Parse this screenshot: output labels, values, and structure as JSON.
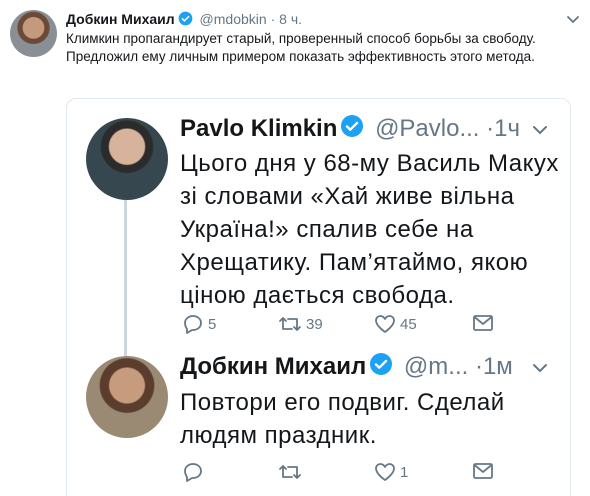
{
  "outer_tweet": {
    "author_name": "Добкин Михаил",
    "author_handle": "@mdobkin",
    "separator": "·",
    "time": "8 ч.",
    "text": "Климкин пропагандирует старый, проверенный способ борьбы за свободу. Предложил ему личным примером показать эффективность этого метода."
  },
  "quoted_thread": [
    {
      "author_name": "Pavlo Klimkin",
      "author_handle": "@Pavlo...",
      "separator": "·",
      "time": "1ч",
      "text": "Цього дня у 68-му Василь Макух зі словами «Хай живе вільна Україна!» спалив себе на Хрещатику. Пам’ятаймо, якою ціною дається свобода.",
      "replies": "5",
      "retweets": "39",
      "likes": "45"
    },
    {
      "author_name": "Добкин Михаил",
      "author_handle": "@m...",
      "separator": "·",
      "time": "1м",
      "text": "Повтори его подвиг. Сделай людям праздник.",
      "replies": "",
      "retweets": "",
      "likes": "1"
    }
  ],
  "icons": {
    "verified": "verified-badge-icon",
    "reply": "reply-icon",
    "retweet": "retweet-icon",
    "like": "heart-icon",
    "dm": "envelope-icon",
    "more": "chevron-down-icon"
  },
  "colors": {
    "verified": "#1da1f2",
    "text": "#14171a",
    "muted": "#657786",
    "border": "#e1e8ed"
  }
}
